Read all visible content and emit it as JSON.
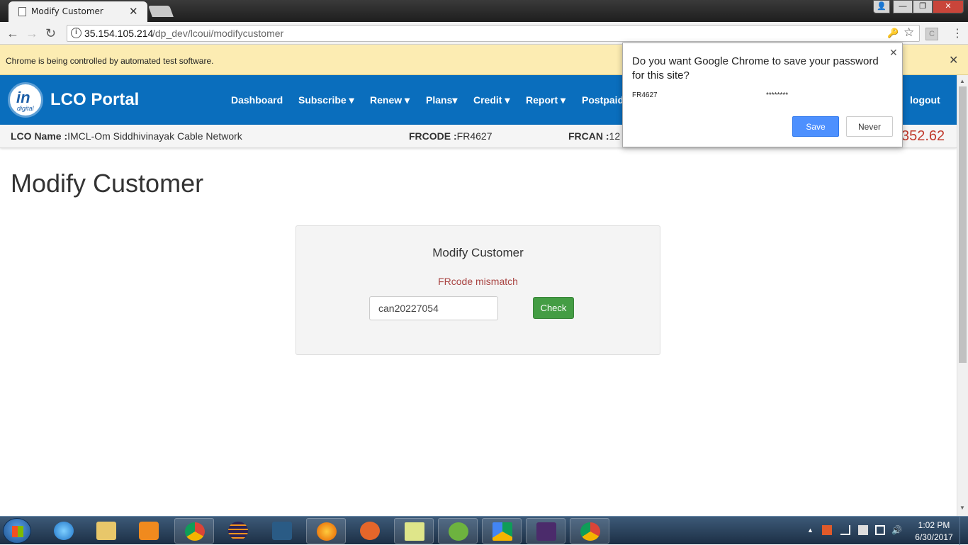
{
  "browser": {
    "tab_title": "Modify Customer",
    "url_host": "35.154.105.214",
    "url_path": "/dp_dev/lcoui/modifycustomer",
    "infobar_text": "Chrome is being controlled by automated test software."
  },
  "password_popup": {
    "question": "Do you want Google Chrome to save your password for this site?",
    "username": "FR4627",
    "password": "********",
    "save_label": "Save",
    "never_label": "Never"
  },
  "site": {
    "brand": "LCO Portal",
    "logo_text": "in",
    "logo_subtext": "digital",
    "nav": [
      {
        "label": "Dashboard"
      },
      {
        "label": "Subscribe ▾"
      },
      {
        "label": "Renew ▾"
      },
      {
        "label": "Plans▾"
      },
      {
        "label": "Credit ▾"
      },
      {
        "label": "Report ▾"
      },
      {
        "label": "Postpaid"
      },
      {
        "label": "logout"
      }
    ]
  },
  "info_strip": {
    "lco_name_label": "LCO Name :",
    "lco_name_value": "IMCL-Om Siddhivinayak Cable Network",
    "frcode_label": "FRCODE :",
    "frcode_value": "FR4627",
    "frcan_label": "FRCAN :",
    "frcan_value": "12",
    "balance": "352.62"
  },
  "page": {
    "title": "Modify Customer",
    "panel_title": "Modify Customer",
    "error": "FRcode mismatch",
    "input_value": "can20227054",
    "check_label": "Check"
  },
  "taskbar": {
    "time": "1:02 PM",
    "date": "6/30/2017"
  },
  "colors": {
    "nav_bg": "#0a6ebd",
    "error": "#a94442",
    "check_btn": "#449d44",
    "balance": "#c0392b",
    "infobar": "#fcecb2"
  }
}
